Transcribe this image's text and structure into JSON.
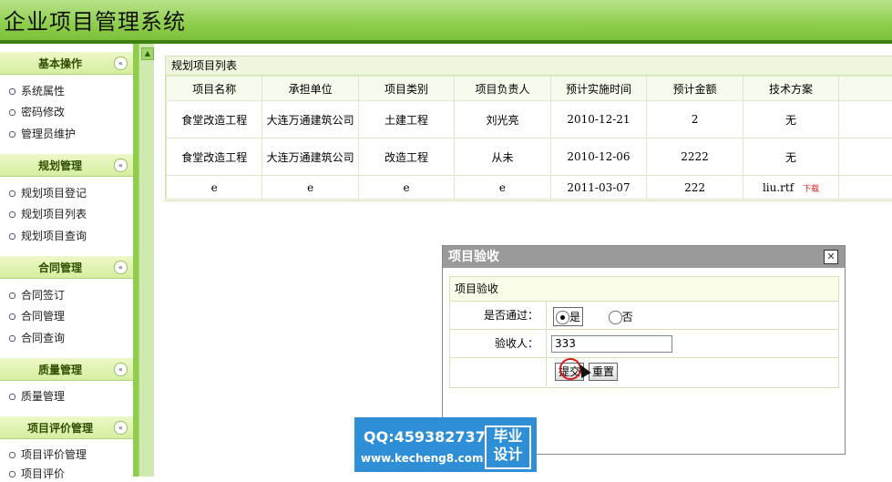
{
  "app": {
    "title": "企业项目管理系统"
  },
  "sidebar": {
    "groups": [
      {
        "title": "基本操作",
        "items": [
          "系统属性",
          "密码修改",
          "管理员维护"
        ]
      },
      {
        "title": "规划管理",
        "items": [
          "规划项目登记",
          "规划项目列表",
          "规划项目查询"
        ]
      },
      {
        "title": "合同管理",
        "items": [
          "合同签订",
          "合同管理",
          "合同查询"
        ]
      },
      {
        "title": "质量管理",
        "items": [
          "质量管理"
        ]
      },
      {
        "title": "项目评价管理",
        "items": [
          "项目评价管理",
          "项目评价"
        ]
      }
    ],
    "toggle_glyph": "«"
  },
  "list": {
    "title": "规划项目列表",
    "columns": [
      "项目名称",
      "承担单位",
      "项目类别",
      "项目负责人",
      "预计实施时间",
      "预计金额",
      "技术方案"
    ],
    "rows": [
      [
        "食堂改造工程",
        "大连万通建筑公司",
        "土建工程",
        "刘光亮",
        "2010-12-21",
        "2",
        "无"
      ],
      [
        "食堂改造工程",
        "大连万通建筑公司",
        "改造工程",
        "从未",
        "2010-12-06",
        "2222",
        "无"
      ],
      [
        "e",
        "e",
        "e",
        "e",
        "2011-03-07",
        "222",
        "liu.rtf"
      ]
    ],
    "download_label": "下载"
  },
  "dialog": {
    "title": "项目验收",
    "close_glyph": "✕",
    "form_title": "项目验收",
    "pass_label": "是否通过：",
    "yes": "是",
    "no": "否",
    "selected": "是",
    "inspector_label": "验收人：",
    "inspector_value": "333",
    "submit": "提交",
    "reset": "重置"
  },
  "watermark": {
    "qq": "QQ:459382737",
    "url": "www.kecheng8.com",
    "tag_line1": "毕业",
    "tag_line2": "设计"
  }
}
